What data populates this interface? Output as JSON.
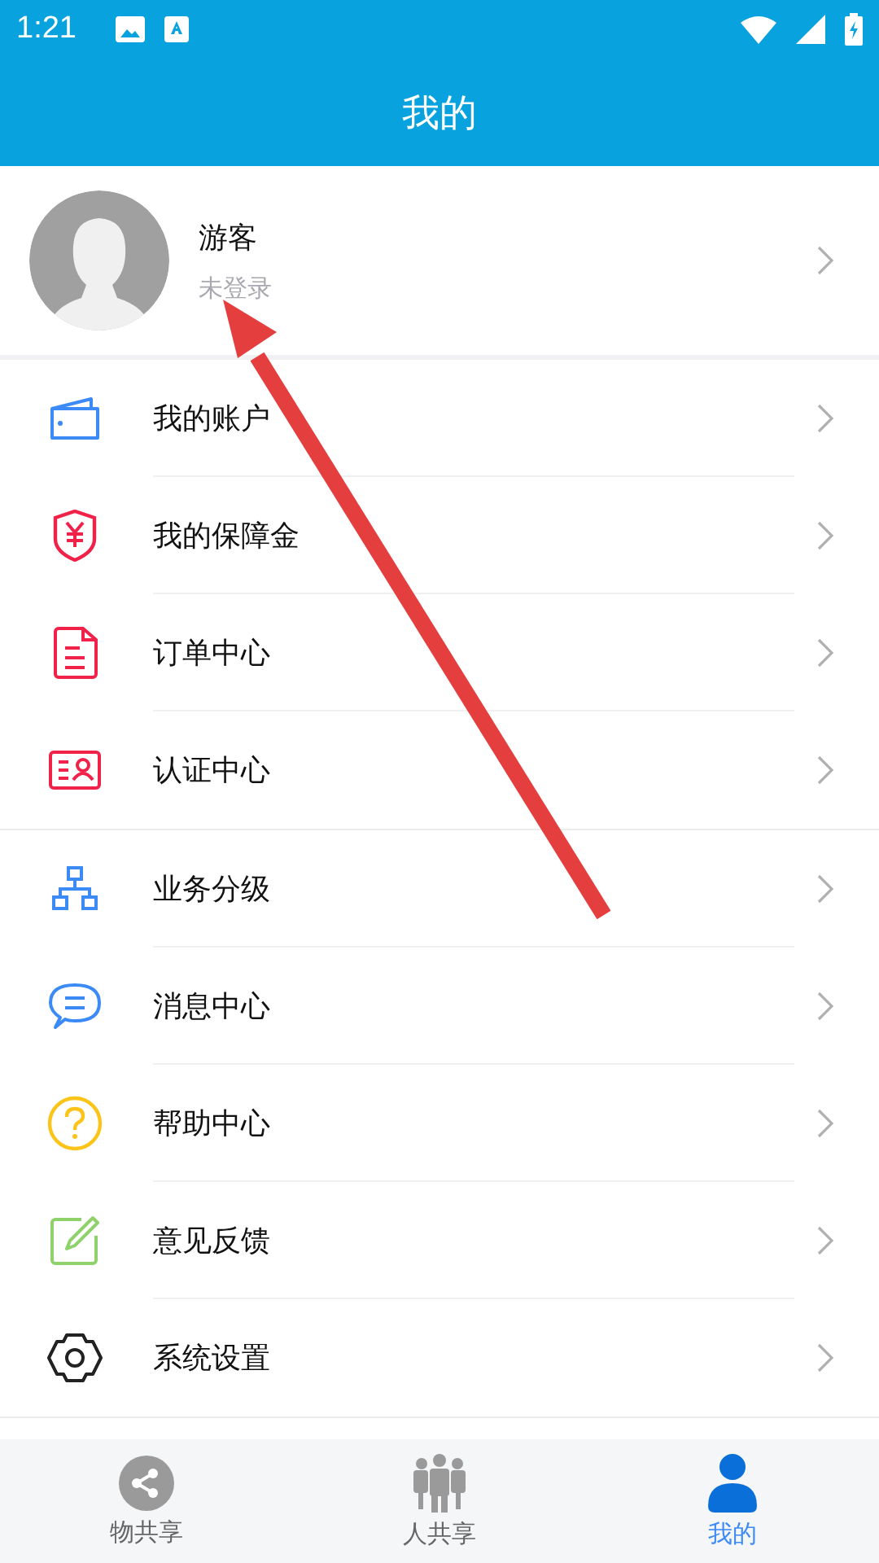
{
  "status_bar": {
    "time": "1:21"
  },
  "header": {
    "title": "我的"
  },
  "profile": {
    "name": "游客",
    "status": "未登录"
  },
  "menu_sections": [
    {
      "items": [
        {
          "label": "我的账户"
        },
        {
          "label": "我的保障金"
        },
        {
          "label": "订单中心"
        },
        {
          "label": "认证中心"
        }
      ]
    },
    {
      "items": [
        {
          "label": "业务分级"
        },
        {
          "label": "消息中心"
        },
        {
          "label": "帮助中心"
        },
        {
          "label": "意见反馈"
        },
        {
          "label": "系统设置"
        }
      ]
    }
  ],
  "tab_bar": [
    {
      "label": "物共享",
      "selected": false
    },
    {
      "label": "人共享",
      "selected": false
    },
    {
      "label": "我的",
      "selected": true
    }
  ]
}
